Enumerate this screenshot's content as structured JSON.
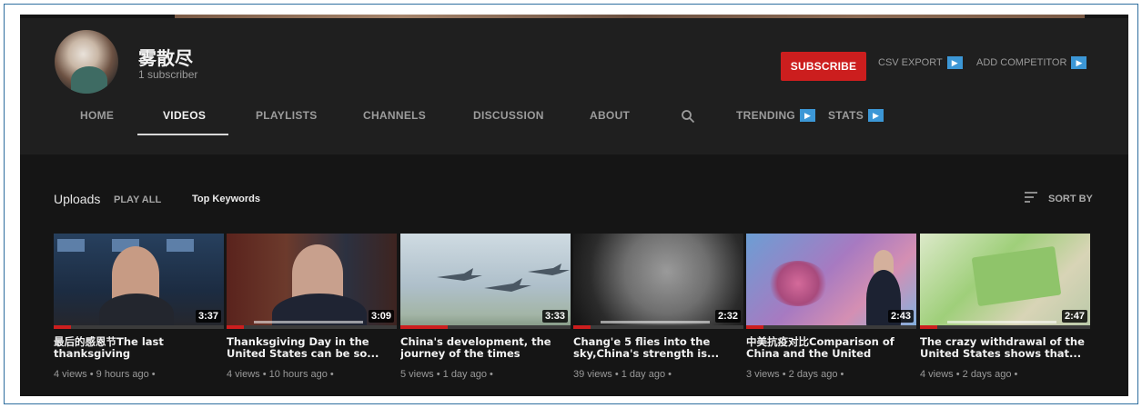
{
  "channel": {
    "name": "雾散尽",
    "subscribers": "1 subscriber",
    "subscribe_label": "SUBSCRIBE",
    "csv_export_label": "CSV EXPORT",
    "add_competitor_label": "ADD COMPETITOR"
  },
  "tabs": [
    {
      "label": "HOME",
      "active": false
    },
    {
      "label": "VIDEOS",
      "active": true
    },
    {
      "label": "PLAYLISTS",
      "active": false
    },
    {
      "label": "CHANNELS",
      "active": false
    },
    {
      "label": "DISCUSSION",
      "active": false
    },
    {
      "label": "ABOUT",
      "active": false
    }
  ],
  "extra_tabs": {
    "trending": "TRENDING",
    "stats": "STATS"
  },
  "uploads": {
    "label": "Uploads",
    "play_all": "PLAY ALL",
    "top_keywords": "Top Keywords",
    "sort_by": "SORT BY"
  },
  "videos": [
    {
      "title": "最后的感恩节The last thanksgiving",
      "duration": "3:37",
      "meta": "4 views • 9 hours ago •",
      "watched": 0.1
    },
    {
      "title": "Thanksgiving Day in the United States can be so...",
      "duration": "3:09",
      "meta": "4 views • 10 hours ago •",
      "watched": 0.1
    },
    {
      "title": "China's development, the journey of the times",
      "duration": "3:33",
      "meta": "5 views • 1 day ago •",
      "watched": 0.28
    },
    {
      "title": "Chang'e 5 flies into the sky,China's strength is...",
      "duration": "2:32",
      "meta": "39 views • 1 day ago •",
      "watched": 0.1
    },
    {
      "title": "中美抗疫对比Comparison of China and the United States...",
      "duration": "2:43",
      "meta": "3 views • 2 days ago •",
      "watched": 0.1
    },
    {
      "title": "The crazy withdrawal of the United States shows that...",
      "duration": "2:47",
      "meta": "4 views • 2 days ago •",
      "watched": 0.1
    }
  ],
  "colors": {
    "accent": "#cc1e1e",
    "ext_icon": "#3c97d6",
    "background": "#151515"
  }
}
